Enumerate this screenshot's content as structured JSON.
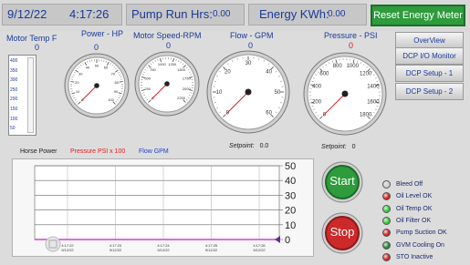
{
  "topbar": {
    "date": "9/12/22",
    "time": "4:17:26",
    "pump_run_label": "Pump Run Hrs:",
    "pump_run_value": "0.00",
    "energy_label": "Energy KWh:",
    "energy_value": "0.00",
    "reset_label": "Reset  Energy Meter"
  },
  "motor_temp": {
    "label": "Motor Temp F",
    "value": "0",
    "ticks": [
      "400",
      "350",
      "300",
      "250",
      "200",
      "150",
      "100",
      "50"
    ],
    "level": 0
  },
  "gauges": [
    {
      "label": "Power - HP",
      "value": "0",
      "value_color": "#1a3a9a",
      "ticks": [
        "0",
        "10",
        "20",
        "30",
        "40",
        "50",
        "60",
        "70",
        "80",
        "90",
        "100"
      ]
    },
    {
      "label": "Motor Speed-RPM",
      "value": "0",
      "value_color": "#1a3a9a",
      "ticks": [
        "0",
        "250",
        "500",
        "750",
        "1000",
        "1250",
        "1500",
        "1750",
        "2000",
        "2250"
      ]
    },
    {
      "label": "Flow - GPM",
      "value": "0",
      "value_color": "#1a3a9a",
      "ticks": [
        "0",
        "10",
        "20",
        "30",
        "40",
        "50",
        "60"
      ]
    },
    {
      "label": "Pressure - PSI",
      "value": "0",
      "value_color": "#d01f1f",
      "ticks": [
        "0",
        "200",
        "400",
        "600",
        "800",
        "1000",
        "1200",
        "1400",
        "1600",
        "1800"
      ]
    }
  ],
  "nav": [
    "OverView",
    "DCP I/O Monitor",
    "DCP Setup - 1",
    "DCP Setup - 2"
  ],
  "legend": {
    "horse_power": "Horse Power",
    "pressure": "Pressure PSI x 100",
    "flow": "Flow GPM",
    "horse_power_color": "#222222",
    "pressure_color": "#e02020",
    "flow_color": "#2040d0"
  },
  "setpoints": {
    "flow_label": "Setpoint:",
    "flow_value": "0.0",
    "pressure_label": "Setpoint:",
    "pressure_value": "0"
  },
  "trend": {
    "y_ticks": [
      "50",
      "40",
      "30",
      "20",
      "10",
      "0"
    ],
    "x_ticks": [
      {
        "time": "4:17:22",
        "date": "9/12/22"
      },
      {
        "time": "4:17:23",
        "date": "9/12/22"
      },
      {
        "time": "4:17:24",
        "date": "9/12/22"
      },
      {
        "time": "4:17:25",
        "date": "9/12/22"
      },
      {
        "time": "4:17:26",
        "date": "9/12/22"
      }
    ],
    "line_color": "#d040d0"
  },
  "buttons": {
    "start": "Start",
    "stop": "Stop",
    "start_color": "#2e9b3c",
    "stop_color": "#cc2a2a"
  },
  "status": [
    {
      "label": "Bleed Off",
      "color": "#cfcfcf"
    },
    {
      "label": "Oil Level OK",
      "color": "#d42020"
    },
    {
      "label": "Oil Temp OK",
      "color": "#33cc33"
    },
    {
      "label": "Oil Filter OK",
      "color": "#33cc33"
    },
    {
      "label": "Pump Suction OK",
      "color": "#d42020"
    },
    {
      "label": "GVM Cooling On",
      "color": "#1e8a2a"
    },
    {
      "label": "STO Inactive",
      "color": "#d42020"
    }
  ]
}
